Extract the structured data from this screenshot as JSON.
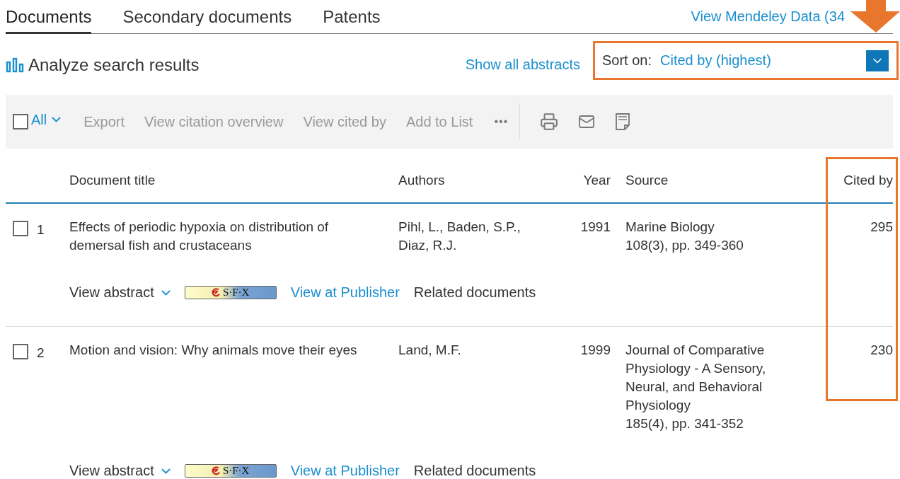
{
  "tabs": [
    {
      "label": "Documents",
      "selected": true
    },
    {
      "label": "Secondary documents",
      "selected": false
    },
    {
      "label": "Patents",
      "selected": false
    }
  ],
  "mendeley_link": "View Mendeley Data (34",
  "analyze": "Analyze search results",
  "show_all_abstracts": "Show all abstracts",
  "sort": {
    "label": "Sort on:",
    "value": "Cited by (highest)"
  },
  "toolbar": {
    "select_all": {
      "label": "All",
      "checked": false
    },
    "actions": [
      "Export",
      "View citation overview",
      "View cited by",
      "Add to List"
    ],
    "more": "•••"
  },
  "table": {
    "columns": [
      "Document title",
      "Authors",
      "Year",
      "Source",
      "Cited by"
    ],
    "rows": [
      {
        "number": "1",
        "checked": false,
        "title": "Effects of periodic hypoxia on distribution of demersal fish and crustaceans",
        "authors": "Pihl, L., Baden, S.P., Diaz, R.J.",
        "year": "1991",
        "source": "Marine Biology",
        "source_detail": "108(3), pp. 349-360",
        "cited_by": "295",
        "view_abstract": "View abstract",
        "sfx": "S·F·X",
        "publisher_link": "View at Publisher",
        "related": "Related documents"
      },
      {
        "number": "2",
        "checked": false,
        "title": "Motion and vision: Why animals move their eyes",
        "authors": "Land, M.F.",
        "year": "1999",
        "source": "Journal of Comparative Physiology - A Sensory, Neural, and Behavioral Physiology",
        "source_detail": "185(4), pp. 341-352",
        "cited_by": "230",
        "view_abstract": "View abstract",
        "sfx": "S·F·X",
        "publisher_link": "View at Publisher",
        "related": "Related documents"
      }
    ]
  }
}
